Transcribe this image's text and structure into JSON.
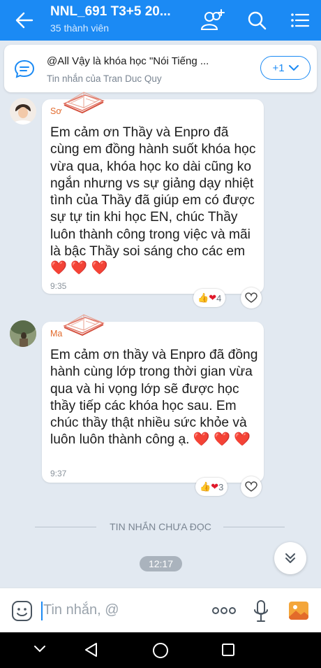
{
  "header": {
    "title": "NNL_691 T3+5 20...",
    "subtitle": "35 thành viên",
    "icons": [
      "back-arrow-icon",
      "add-member-icon",
      "search-icon",
      "menu-list-icon"
    ]
  },
  "pinned": {
    "text": "@All Vậy là khóa học \"Nói Tiếng ...",
    "sub": "Tin nhắn của Tran Duc Quy",
    "more_label": "+1"
  },
  "messages": [
    {
      "sender": "Sơ",
      "text": "Em cảm ơn Thầy và Enpro đã cùng em đồng hành suốt khóa học vừa qua, khóa học ko dài cũng ko ngắn nhưng vs sự giảng dạy nhiệt tình của Thầy đã giúp em có được sự tự tin khi học EN, chúc Thầy luôn thành công trong việc và mãi là bậc Thầy soi sáng cho các em",
      "emoji": "❤️ ❤️ ❤️",
      "time": "9:35",
      "reaction_count": "4"
    },
    {
      "sender": "Ma",
      "text": "Em cảm ơn thầy và Enpro đã đồng hành cùng lớp trong thời gian vừa qua và hi vọng lớp sẽ được học thầy tiếp các khóa học sau. Em chúc thầy thật nhiều sức khỏe và luôn luôn thành công ạ.",
      "emoji": "❤️ ❤️ ❤️",
      "time": "9:37",
      "reaction_count": "3"
    }
  ],
  "unread_label": "TIN NHẮN CHƯA ĐỌC",
  "time_chip": "12:17",
  "input": {
    "placeholder": "Tin nhắn, @"
  },
  "colors": {
    "brand": "#1b8af4",
    "background": "#e2e9f1",
    "sender": "#e26a2c"
  }
}
